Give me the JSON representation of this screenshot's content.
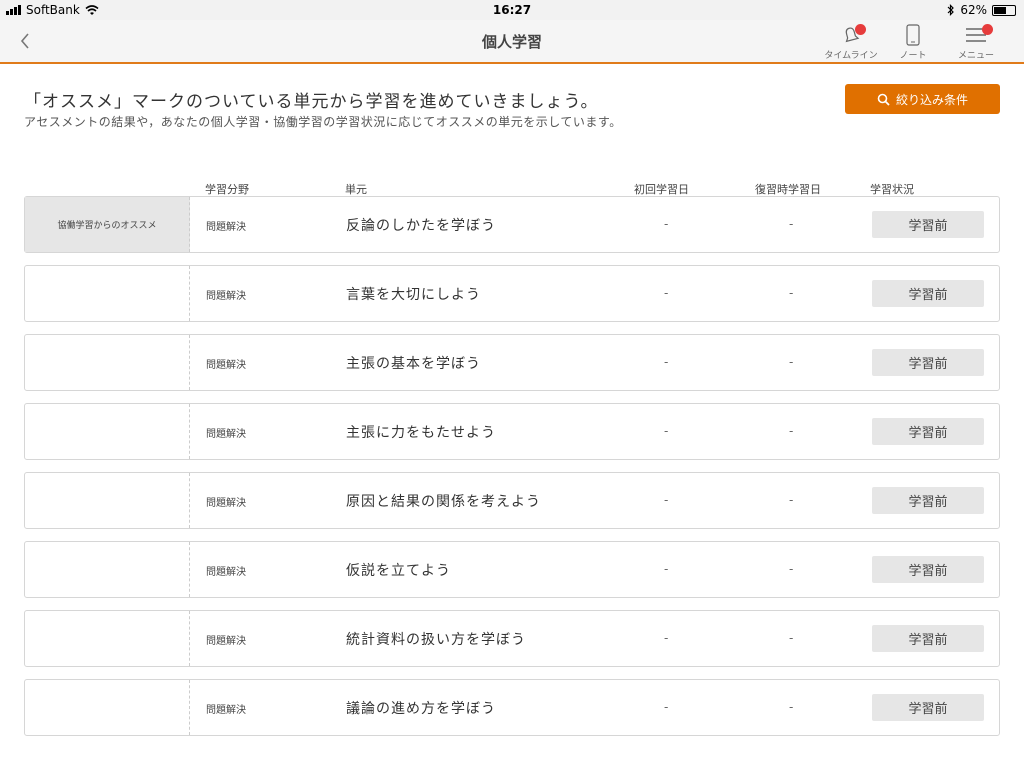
{
  "status_bar": {
    "carrier": "SoftBank",
    "time": "16:27",
    "battery": "62%",
    "battery_level": 0.62
  },
  "nav": {
    "title": "個人学習",
    "timeline_label": "タイムライン",
    "note_label": "ノート",
    "menu_label": "メニュー"
  },
  "header": {
    "headline": "「オススメ」マークのついている単元から学習を進めていきましょう。",
    "subline": "アセスメントの結果や，あなたの個人学習・協働学習の学習状況に応じてオススメの単元を示しています。",
    "filter_label": "絞り込み条件"
  },
  "table": {
    "columns": {
      "field": "学習分野",
      "unit": "単元",
      "first_date": "初回学習日",
      "review_date": "復習時学習日",
      "status": "学習状況"
    },
    "rows": [
      {
        "recommend": "協働学習からのオススメ",
        "field": "問題解決",
        "unit": "反論のしかたを学ぼう",
        "first_date": "-",
        "review_date": "-",
        "status": "学習前"
      },
      {
        "recommend": "",
        "field": "問題解決",
        "unit": "言葉を大切にしよう",
        "first_date": "-",
        "review_date": "-",
        "status": "学習前"
      },
      {
        "recommend": "",
        "field": "問題解決",
        "unit": "主張の基本を学ぼう",
        "first_date": "-",
        "review_date": "-",
        "status": "学習前"
      },
      {
        "recommend": "",
        "field": "問題解決",
        "unit": "主張に力をもたせよう",
        "first_date": "-",
        "review_date": "-",
        "status": "学習前"
      },
      {
        "recommend": "",
        "field": "問題解決",
        "unit": "原因と結果の関係を考えよう",
        "first_date": "-",
        "review_date": "-",
        "status": "学習前"
      },
      {
        "recommend": "",
        "field": "問題解決",
        "unit": "仮説を立てよう",
        "first_date": "-",
        "review_date": "-",
        "status": "学習前"
      },
      {
        "recommend": "",
        "field": "問題解決",
        "unit": "統計資料の扱い方を学ぼう",
        "first_date": "-",
        "review_date": "-",
        "status": "学習前"
      },
      {
        "recommend": "",
        "field": "問題解決",
        "unit": "議論の進め方を学ぼう",
        "first_date": "-",
        "review_date": "-",
        "status": "学習前"
      }
    ]
  },
  "colors": {
    "accent": "#e07000",
    "nav_underline": "#e07b1a",
    "badge": "#e63c3c",
    "pill_bg": "#e6e6e6"
  },
  "icons": {
    "back": "chevron-left-icon",
    "timeline": "bell-icon",
    "note": "tablet-icon",
    "menu": "hamburger-icon",
    "filter": "search-icon",
    "wifi": "wifi-icon",
    "bluetooth": "bluetooth-icon"
  }
}
